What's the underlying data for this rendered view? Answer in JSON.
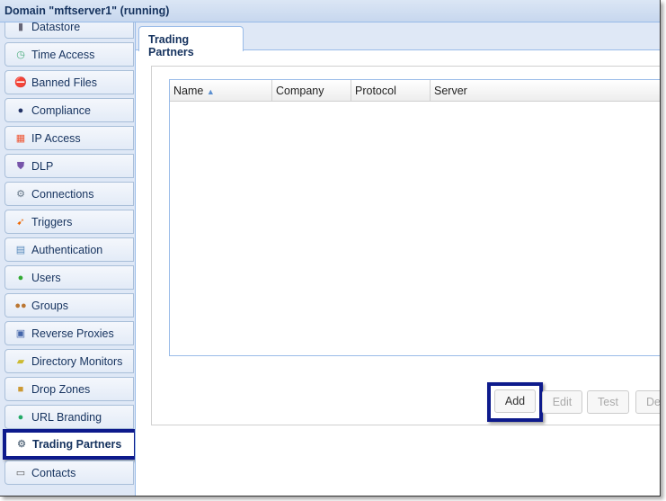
{
  "window": {
    "title": "Domain \"mftserver1\" (running)"
  },
  "sidebar": {
    "items": [
      {
        "label": "Datastore",
        "icon": "database-icon"
      },
      {
        "label": "Time Access",
        "icon": "clock-icon"
      },
      {
        "label": "Banned Files",
        "icon": "banned-file-icon"
      },
      {
        "label": "Compliance",
        "icon": "officer-icon"
      },
      {
        "label": "IP Access",
        "icon": "firewall-icon"
      },
      {
        "label": "DLP",
        "icon": "shield-icon"
      },
      {
        "label": "Connections",
        "icon": "gear-icon"
      },
      {
        "label": "Triggers",
        "icon": "trigger-icon"
      },
      {
        "label": "Authentication",
        "icon": "id-card-icon"
      },
      {
        "label": "Users",
        "icon": "user-icon"
      },
      {
        "label": "Groups",
        "icon": "group-icon"
      },
      {
        "label": "Reverse Proxies",
        "icon": "network-icon"
      },
      {
        "label": "Directory Monitors",
        "icon": "folder-monitor-icon"
      },
      {
        "label": "Drop Zones",
        "icon": "box-icon"
      },
      {
        "label": "URL Branding",
        "icon": "globe-icon"
      },
      {
        "label": "Trading Partners",
        "icon": "gear-icon",
        "selected": true
      },
      {
        "label": "Contacts",
        "icon": "address-book-icon"
      }
    ]
  },
  "main": {
    "tab": "Trading Partners",
    "columns": [
      "Name",
      "Company",
      "Protocol",
      "Server"
    ],
    "sort": {
      "column": "Name",
      "direction": "ascending"
    },
    "buttons": {
      "add": "Add",
      "edit": "Edit",
      "test": "Test",
      "delete": "De"
    }
  }
}
